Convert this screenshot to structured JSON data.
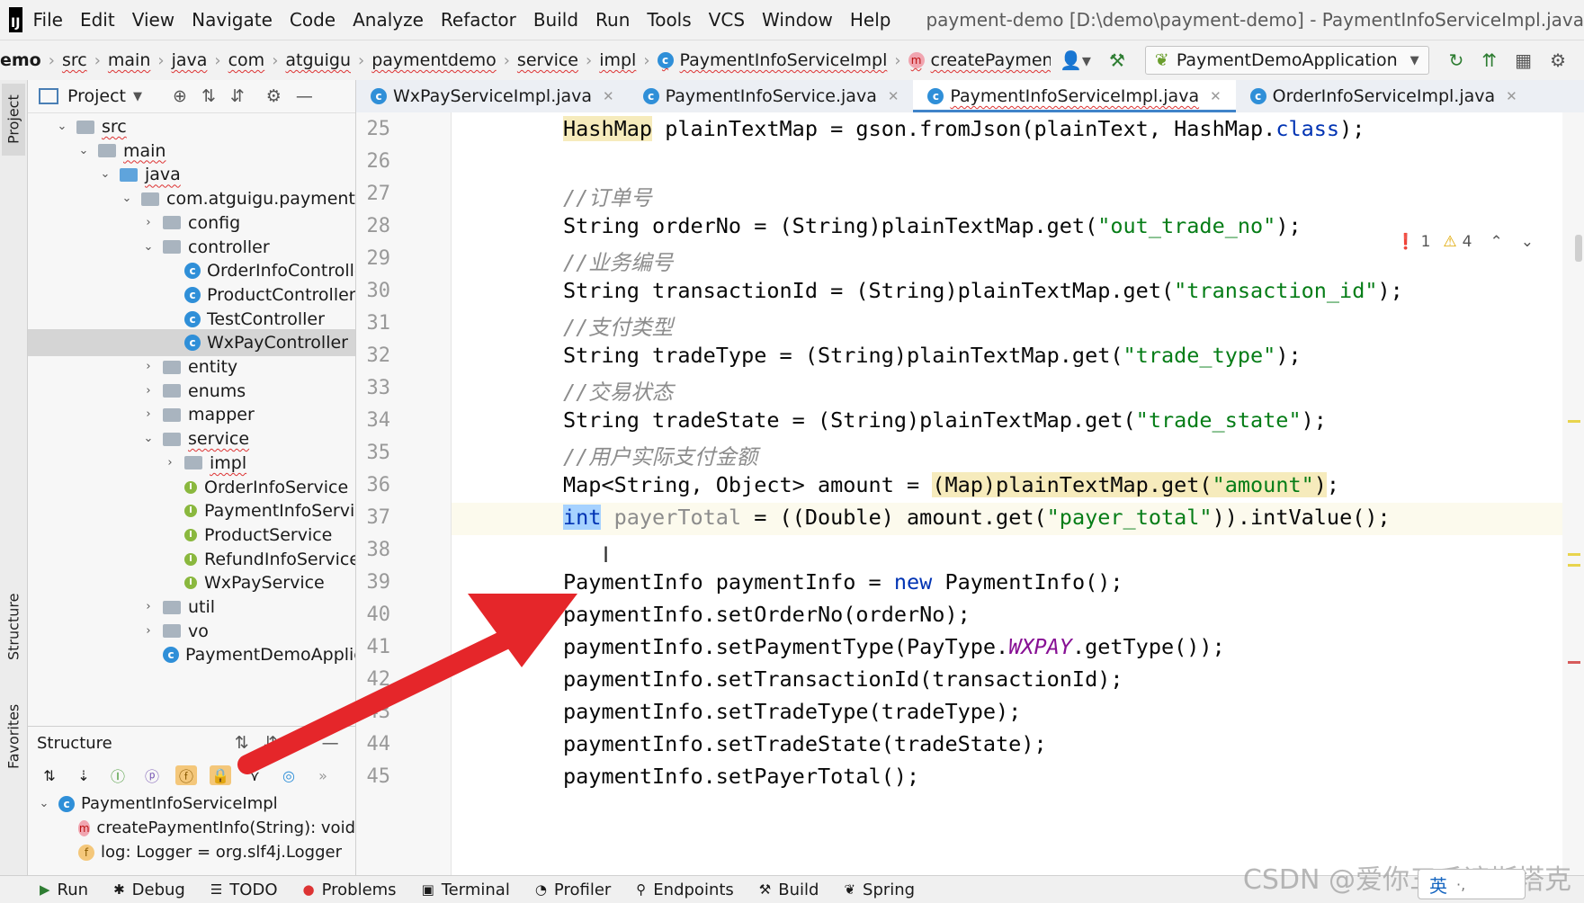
{
  "menu": {
    "logo": "IJ",
    "items": [
      "File",
      "Edit",
      "View",
      "Navigate",
      "Code",
      "Analyze",
      "Refactor",
      "Build",
      "Run",
      "Tools",
      "VCS",
      "Window",
      "Help"
    ],
    "window_title": "payment-demo [D:\\demo\\payment-demo] - PaymentInfoServiceImpl.java"
  },
  "breadcrumb": {
    "items": [
      "emo",
      "src",
      "main",
      "java",
      "com",
      "atguigu",
      "paymentdemo",
      "service",
      "impl",
      "PaymentInfoServiceImpl",
      "createPaymentInfo"
    ]
  },
  "run_config": {
    "label": "PaymentDemoApplication"
  },
  "left_strip": {
    "project": "Project",
    "structure": "Structure",
    "favorites": "Favorites"
  },
  "project_panel": {
    "title": "Project",
    "tree": [
      {
        "label": "src",
        "depth": 1,
        "arrow": "⌄",
        "kind": "folder"
      },
      {
        "label": "main",
        "depth": 2,
        "arrow": "⌄",
        "kind": "folder"
      },
      {
        "label": "java",
        "depth": 3,
        "arrow": "⌄",
        "kind": "folder-blue"
      },
      {
        "label": "com.atguigu.paymentdemo",
        "depth": 4,
        "arrow": "⌄",
        "kind": "folder"
      },
      {
        "label": "config",
        "depth": 5,
        "arrow": "›",
        "kind": "folder"
      },
      {
        "label": "controller",
        "depth": 5,
        "arrow": "⌄",
        "kind": "folder"
      },
      {
        "label": "OrderInfoController",
        "depth": 6,
        "arrow": "",
        "kind": "class"
      },
      {
        "label": "ProductController",
        "depth": 6,
        "arrow": "",
        "kind": "class"
      },
      {
        "label": "TestController",
        "depth": 6,
        "arrow": "",
        "kind": "class"
      },
      {
        "label": "WxPayController",
        "depth": 6,
        "arrow": "",
        "kind": "class",
        "selected": true
      },
      {
        "label": "entity",
        "depth": 5,
        "arrow": "›",
        "kind": "folder"
      },
      {
        "label": "enums",
        "depth": 5,
        "arrow": "›",
        "kind": "folder"
      },
      {
        "label": "mapper",
        "depth": 5,
        "arrow": "›",
        "kind": "folder"
      },
      {
        "label": "service",
        "depth": 5,
        "arrow": "⌄",
        "kind": "folder"
      },
      {
        "label": "impl",
        "depth": 6,
        "arrow": "›",
        "kind": "folder"
      },
      {
        "label": "OrderInfoService",
        "depth": 6,
        "arrow": "",
        "kind": "interface"
      },
      {
        "label": "PaymentInfoService",
        "depth": 6,
        "arrow": "",
        "kind": "interface"
      },
      {
        "label": "ProductService",
        "depth": 6,
        "arrow": "",
        "kind": "interface"
      },
      {
        "label": "RefundInfoService",
        "depth": 6,
        "arrow": "",
        "kind": "interface"
      },
      {
        "label": "WxPayService",
        "depth": 6,
        "arrow": "",
        "kind": "interface"
      },
      {
        "label": "util",
        "depth": 5,
        "arrow": "›",
        "kind": "folder"
      },
      {
        "label": "vo",
        "depth": 5,
        "arrow": "›",
        "kind": "folder"
      },
      {
        "label": "PaymentDemoApplication",
        "depth": 5,
        "arrow": "",
        "kind": "class"
      }
    ]
  },
  "structure_panel": {
    "title": "Structure",
    "items": [
      {
        "label": "PaymentInfoServiceImpl",
        "badge": "c"
      },
      {
        "label": "createPaymentInfo(String): void",
        "badge": "m"
      },
      {
        "label": "log: Logger = org.slf4j.Logger",
        "badge": "f"
      }
    ]
  },
  "tabs": [
    {
      "label": "WxPayServiceImpl.java",
      "active": false
    },
    {
      "label": "PaymentInfoService.java",
      "active": false
    },
    {
      "label": "PaymentInfoServiceImpl.java",
      "active": true
    },
    {
      "label": "OrderInfoServiceImpl.java",
      "active": false
    }
  ],
  "inspection": {
    "errors": "1",
    "warnings": "4"
  },
  "editor": {
    "current_line": 37,
    "lines": [
      {
        "n": "25",
        "html": "<span class=\"hl-yellow\">HashMap</span> plainTextMap = gson.fromJson(plainText, HashMap.<span class=\"kw\">class</span>);"
      },
      {
        "n": "26",
        "html": ""
      },
      {
        "n": "27",
        "html": "<span class=\"cmt\">//订单号</span>"
      },
      {
        "n": "28",
        "html": "String orderNo = (String)plainTextMap.get(<span class=\"str\">\"out_trade_no\"</span>);"
      },
      {
        "n": "29",
        "html": "<span class=\"cmt\">//业务编号</span>"
      },
      {
        "n": "30",
        "html": "String transactionId = (String)plainTextMap.get(<span class=\"str\">\"transaction_id\"</span>);"
      },
      {
        "n": "31",
        "html": "<span class=\"cmt\">//支付类型</span>"
      },
      {
        "n": "32",
        "html": "String tradeType = (String)plainTextMap.get(<span class=\"str\">\"trade_type\"</span>);"
      },
      {
        "n": "33",
        "html": "<span class=\"cmt\">//交易状态</span>"
      },
      {
        "n": "34",
        "html": "String tradeState = (String)plainTextMap.get(<span class=\"str\">\"trade_state\"</span>);"
      },
      {
        "n": "35",
        "html": "<span class=\"cmt\">//用户实际支付金额</span>"
      },
      {
        "n": "36",
        "html": "Map&lt;String, Object&gt; amount = <span class=\"hl-yellow\">(Map)plainTextMap.get(<span class=\"str\">\"amount\"</span>)</span>;"
      },
      {
        "n": "37",
        "html": "<span class=\"hl-sel kw\">int</span> <span class=\"unused\">payerTotal</span> = ((Double) amount.get(<span class=\"str\">\"payer_total\"</span>)).intValue();"
      },
      {
        "n": "38",
        "html": ""
      },
      {
        "n": "39",
        "html": "PaymentInfo paymentInfo = <span class=\"kw\">new</span> PaymentInfo();"
      },
      {
        "n": "40",
        "html": "paymentInfo.setOrderNo(orderNo);"
      },
      {
        "n": "41",
        "html": "paymentInfo.setPaymentType(PayType.<span class=\"const\">WXPAY</span>.getType());"
      },
      {
        "n": "42",
        "html": "paymentInfo.setTransactionId(transactionId);"
      },
      {
        "n": "43",
        "html": "paymentInfo.setTradeType(tradeType);"
      },
      {
        "n": "44",
        "html": "paymentInfo.setTradeState(tradeState);"
      },
      {
        "n": "45",
        "html": "paymentInfo.setPayerTotal();"
      }
    ]
  },
  "bottom_tabs": [
    {
      "label": "Run",
      "icon": "▶"
    },
    {
      "label": "Debug",
      "icon": "✱"
    },
    {
      "label": "TODO",
      "icon": "☰"
    },
    {
      "label": "Problems",
      "icon": "●"
    },
    {
      "label": "Terminal",
      "icon": "▣"
    },
    {
      "label": "Profiler",
      "icon": "◔"
    },
    {
      "label": "Endpoints",
      "icon": "⚲"
    },
    {
      "label": "Build",
      "icon": "⚒"
    },
    {
      "label": "Spring",
      "icon": "❦"
    }
  ],
  "watermark": "CSDN @爱你三千遍斯塔克",
  "ime": {
    "label": "英"
  },
  "colors": {
    "accent": "#4083c9",
    "keyword": "#0033b3",
    "string": "#067d17",
    "comment": "#8c8c8c",
    "arrow": "#e5262a"
  }
}
